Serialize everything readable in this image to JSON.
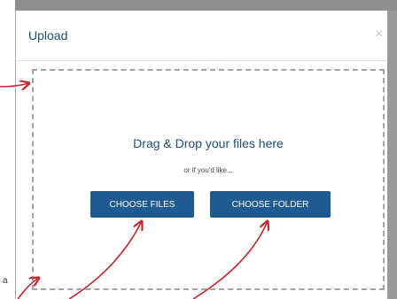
{
  "modal": {
    "title": "Upload",
    "close_glyph": "×",
    "dropzone": {
      "heading": "Drag & Drop your files here",
      "subtext": "or if you'd like...",
      "buttons": {
        "choose_files": "CHOOSE FILES",
        "choose_folder": "CHOOSE FOLDER"
      }
    }
  },
  "stray_text": "a",
  "colors": {
    "accent": "#1f5b92",
    "title_text": "#1f4f7a",
    "annotation_arrow": "#c0282e"
  },
  "icons": {
    "close": "close-icon",
    "arrows": "annotation-arrow"
  }
}
